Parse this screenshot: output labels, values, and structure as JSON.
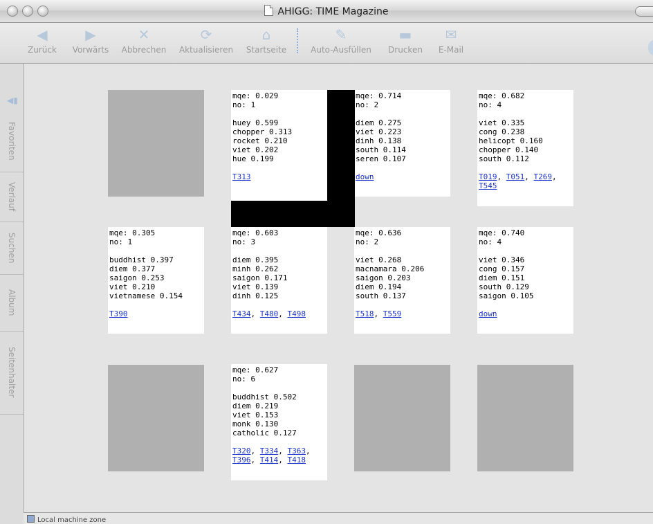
{
  "window": {
    "title": "AHIGG: TIME Magazine"
  },
  "toolbar": {
    "buttons": [
      {
        "label": "Zurück",
        "icon": "back-arrow-icon"
      },
      {
        "label": "Vorwärts",
        "icon": "forward-arrow-icon"
      },
      {
        "label": "Abbrechen",
        "icon": "stop-icon"
      },
      {
        "label": "Aktualisieren",
        "icon": "refresh-icon"
      },
      {
        "label": "Startseite",
        "icon": "home-icon"
      },
      {
        "label": "Auto-Ausfüllen",
        "icon": "autofill-icon"
      },
      {
        "label": "Drucken",
        "icon": "print-icon"
      },
      {
        "label": "E-Mail",
        "icon": "mail-icon"
      }
    ]
  },
  "sidebar": {
    "tabs": [
      "Favoriten",
      "Verlauf",
      "Suchen",
      "Album",
      "Seitenhalter"
    ]
  },
  "cards": [
    {
      "mqe": "mqe: 0.029",
      "no": "no: 1",
      "terms": [
        "huey 0.599",
        "chopper 0.313",
        "rocket 0.210",
        "viet 0.202",
        "hue 0.199"
      ],
      "links_line1": [
        "T313"
      ],
      "links_line2": []
    },
    {
      "mqe": "mqe: 0.714",
      "no": "no: 2",
      "terms": [
        "diem 0.275",
        "viet 0.223",
        "dinh 0.138",
        "south 0.114",
        "seren 0.107"
      ],
      "links_line1": [
        "down"
      ],
      "links_line2": []
    },
    {
      "mqe": "mqe: 0.682",
      "no": "no: 4",
      "terms": [
        "viet 0.335",
        "cong 0.238",
        "helicopt 0.160",
        "chopper 0.140",
        "south 0.112"
      ],
      "links_line1": [
        "T019",
        "T051",
        "T269"
      ],
      "links_line2": [
        "T545"
      ]
    },
    {
      "mqe": "mqe: 0.305",
      "no": "no: 1",
      "terms": [
        "buddhist 0.397",
        "diem 0.377",
        "saigon 0.253",
        "viet 0.210",
        "vietnamese 0.154"
      ],
      "links_line1": [
        "T390"
      ],
      "links_line2": []
    },
    {
      "mqe": "mqe: 0.603",
      "no": "no: 3",
      "terms": [
        "diem 0.395",
        "minh 0.262",
        "saigon 0.171",
        "viet 0.139",
        "dinh 0.125"
      ],
      "links_line1": [
        "T434",
        "T480",
        "T498"
      ],
      "links_line2": []
    },
    {
      "mqe": "mqe: 0.636",
      "no": "no: 2",
      "terms": [
        "viet 0.268",
        "macnamara 0.206",
        "saigon 0.203",
        "diem 0.194",
        "south 0.137"
      ],
      "links_line1": [
        "T518",
        "T559"
      ],
      "links_line2": []
    },
    {
      "mqe": "mqe: 0.740",
      "no": "no: 4",
      "terms": [
        "viet 0.346",
        "cong 0.157",
        "diem 0.151",
        "south 0.129",
        "saigon 0.105"
      ],
      "links_line1": [
        "down"
      ],
      "links_line2": []
    },
    {
      "mqe": "mqe: 0.627",
      "no": "no: 6",
      "terms": [
        "buddhist 0.502",
        "diem 0.219",
        "viet 0.153",
        "monk 0.130",
        "catholic 0.127"
      ],
      "links_line1": [
        "T320",
        "T334",
        "T363"
      ],
      "links_line2": [
        "T396",
        "T414",
        "T418"
      ]
    }
  ],
  "status": {
    "zone": "Local machine zone"
  }
}
